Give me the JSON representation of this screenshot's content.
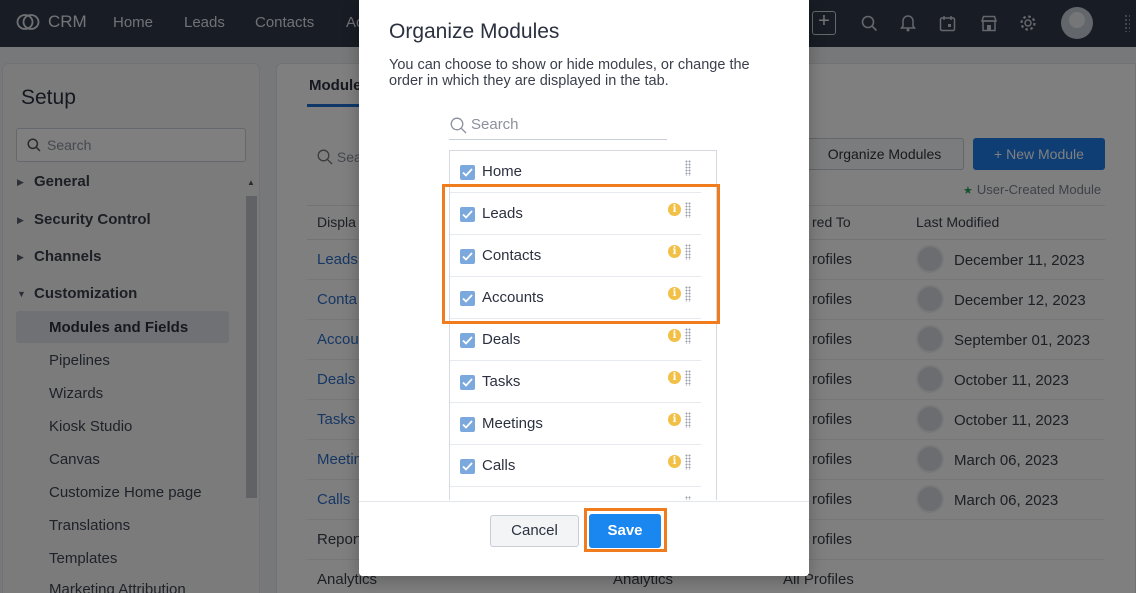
{
  "topbar": {
    "app_name": "CRM",
    "nav": [
      "Home",
      "Leads",
      "Contacts",
      "Ac"
    ],
    "icons": [
      "search-icon",
      "bell-icon",
      "calendar-icon",
      "marketplace-icon",
      "gear-icon"
    ]
  },
  "sidebar": {
    "title": "Setup",
    "search_placeholder": "Search",
    "sections": [
      {
        "label": "General"
      },
      {
        "label": "Security Control"
      },
      {
        "label": "Channels"
      },
      {
        "label": "Customization"
      }
    ],
    "subitems": [
      {
        "label": "Modules and Fields"
      },
      {
        "label": "Pipelines"
      },
      {
        "label": "Wizards"
      },
      {
        "label": "Kiosk Studio"
      },
      {
        "label": "Canvas"
      },
      {
        "label": "Customize Home page"
      },
      {
        "label": "Translations"
      },
      {
        "label": "Templates"
      },
      {
        "label": "Marketing Attribution"
      }
    ]
  },
  "main": {
    "tab_label": "Module",
    "search_placeholder": "Sea",
    "organize_button": "Organize Modules",
    "new_module_button": "+ New Module",
    "user_created_note": "User-Created Module",
    "columns": {
      "display": "Displa",
      "shared": "red To",
      "modified": "Last Modified"
    },
    "rows": [
      {
        "name": "Leads",
        "shared": "rofiles",
        "date": "December 11, 2023"
      },
      {
        "name": "Conta",
        "shared": "rofiles",
        "date": "December 12, 2023"
      },
      {
        "name": "Accou",
        "shared": "rofiles",
        "date": "September 01, 2023"
      },
      {
        "name": "Deals",
        "shared": "rofiles",
        "date": "October 11, 2023"
      },
      {
        "name": "Tasks",
        "shared": "rofiles",
        "date": "October 11, 2023"
      },
      {
        "name": "Meetin",
        "shared": "rofiles",
        "date": "March 06, 2023"
      },
      {
        "name": "Calls",
        "shared": "rofiles",
        "date": "March 06, 2023"
      },
      {
        "name": "Report",
        "shared": "rofiles",
        "date": ""
      },
      {
        "name": "Analytics",
        "shared": "All Profiles",
        "date": "",
        "mid": "Analytics"
      }
    ]
  },
  "modal": {
    "title": "Organize Modules",
    "description": "You can choose to show or hide modules, or change the order in which they are displayed in the tab.",
    "search_placeholder": "Search",
    "items": [
      {
        "label": "Home",
        "checked": true,
        "info": false
      },
      {
        "label": "Leads",
        "checked": true,
        "info": true
      },
      {
        "label": "Contacts",
        "checked": true,
        "info": true
      },
      {
        "label": "Accounts",
        "checked": true,
        "info": true
      },
      {
        "label": "Deals",
        "checked": true,
        "info": true
      },
      {
        "label": "Tasks",
        "checked": true,
        "info": true
      },
      {
        "label": "Meetings",
        "checked": true,
        "info": true
      },
      {
        "label": "Calls",
        "checked": true,
        "info": true
      },
      {
        "label": "",
        "checked": false,
        "info": false
      }
    ],
    "cancel_label": "Cancel",
    "save_label": "Save"
  },
  "colors": {
    "accent": "#1a86f0",
    "highlight": "#f07c1e",
    "topbar": "#313949",
    "link": "#2d6fc9"
  }
}
